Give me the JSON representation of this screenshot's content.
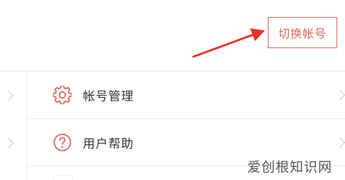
{
  "header": {
    "switch_account_label": "切换帐号"
  },
  "menu": {
    "items": [
      {
        "label": "帐号管理",
        "icon": "gear-icon"
      },
      {
        "label": "用户帮助",
        "icon": "help-circle-icon"
      }
    ]
  },
  "watermark": {
    "text": "爱创根知识网"
  },
  "colors": {
    "accent": "#e0655a",
    "text": "#333333",
    "divider": "#ececec",
    "chevron": "#c8c8c8"
  }
}
